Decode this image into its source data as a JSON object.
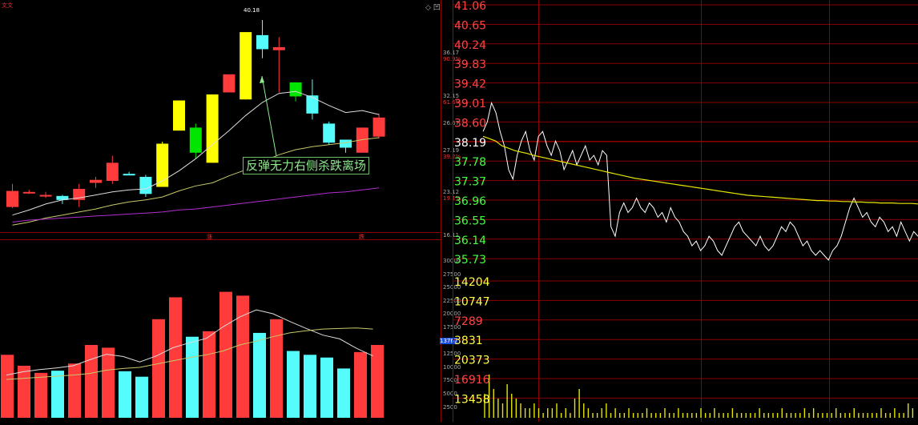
{
  "header": {
    "left_tag": "文文",
    "right_tag": "◇ 凹"
  },
  "annotation": {
    "text": "反弹无力右侧杀跌离场"
  },
  "kline_labels": {
    "high_marker": "40.18",
    "scale_top": "36.17",
    "scale_top_pct": "90.9%",
    "scale_mid": "32.15",
    "scale_mid_pct": "61.6%",
    "scale_low": "26.67",
    "scale_low2": "27.19",
    "scale_low2_pct": "39.2%",
    "scale_bottom": "23.12",
    "scale_bottom_pct": "19.1%",
    "scale_base": "16.11",
    "marker_a": "涨",
    "marker_b": "跌"
  },
  "volume_axis": {
    "ticks": [
      "30000",
      "27500",
      "25000",
      "22500",
      "20000",
      "17500",
      "13767",
      "12500",
      "10000",
      "7500",
      "5000",
      "2500"
    ],
    "highlight": "13767"
  },
  "chart_data": [
    {
      "type": "candlestick",
      "title": "",
      "candles": [
        {
          "o": 23.2,
          "h": 23.9,
          "l": 21.5,
          "c": 21.6,
          "color": "red"
        },
        {
          "o": 23.1,
          "h": 23.3,
          "l": 22.9,
          "c": 23.0,
          "color": "red"
        },
        {
          "o": 22.8,
          "h": 23.1,
          "l": 22.5,
          "c": 22.8,
          "color": "red"
        },
        {
          "o": 22.3,
          "h": 22.8,
          "l": 21.9,
          "c": 22.7,
          "color": "cyan"
        },
        {
          "o": 23.4,
          "h": 23.9,
          "l": 21.6,
          "c": 22.3,
          "color": "red"
        },
        {
          "o": 24.0,
          "h": 24.6,
          "l": 23.5,
          "c": 24.3,
          "color": "red"
        },
        {
          "o": 26.0,
          "h": 26.7,
          "l": 23.9,
          "c": 24.2,
          "color": "red"
        },
        {
          "o": 24.9,
          "h": 25.1,
          "l": 24.8,
          "c": 24.9,
          "color": "cyan"
        },
        {
          "o": 24.6,
          "h": 24.8,
          "l": 22.6,
          "c": 22.9,
          "color": "cyan"
        },
        {
          "o": 23.6,
          "h": 28.1,
          "l": 23.6,
          "c": 27.9,
          "color": "yellow"
        },
        {
          "o": 29.2,
          "h": 31.9,
          "l": 29.2,
          "c": 32.2,
          "color": "yellow"
        },
        {
          "o": 29.5,
          "h": 29.9,
          "l": 26.4,
          "c": 27.0,
          "color": "green"
        },
        {
          "o": 26.0,
          "h": 32.8,
          "l": 26.0,
          "c": 32.8,
          "color": "yellow"
        },
        {
          "o": 33.0,
          "h": 34.8,
          "l": 33.0,
          "c": 34.8,
          "color": "red"
        },
        {
          "o": 32.3,
          "h": 39.0,
          "l": 32.3,
          "c": 39.0,
          "color": "yellow"
        },
        {
          "o": 38.7,
          "h": 40.2,
          "l": 36.4,
          "c": 37.3,
          "color": "cyan"
        },
        {
          "o": 37.5,
          "h": 38.5,
          "l": 33.0,
          "c": 37.2,
          "color": "red"
        },
        {
          "o": 34.0,
          "h": 34.0,
          "l": 32.1,
          "c": 32.6,
          "color": "green"
        },
        {
          "o": 32.7,
          "h": 34.3,
          "l": 30.3,
          "c": 30.9,
          "color": "cyan"
        },
        {
          "o": 29.9,
          "h": 30.1,
          "l": 27.8,
          "c": 28.0,
          "color": "cyan"
        },
        {
          "o": 28.3,
          "h": 28.3,
          "l": 27.0,
          "c": 27.5,
          "color": "cyan"
        },
        {
          "o": 29.5,
          "h": 29.5,
          "l": 27.0,
          "c": 27.0,
          "color": "red"
        },
        {
          "o": 30.5,
          "h": 30.9,
          "l": 28.4,
          "c": 28.6,
          "color": "red"
        }
      ],
      "ma_white": [
        20.8,
        21.3,
        21.9,
        22.3,
        22.5,
        22.8,
        23.1,
        23.3,
        23.4,
        24.2,
        25.2,
        26.4,
        27.8,
        29.2,
        30.7,
        32.0,
        32.9,
        33.1,
        32.5,
        31.7,
        31.0,
        31.2,
        30.8
      ],
      "ma_yellow": [
        19.8,
        20.1,
        20.5,
        20.8,
        21.1,
        21.4,
        21.8,
        22.1,
        22.3,
        22.6,
        23.2,
        23.7,
        24.0,
        24.7,
        25.3,
        26.1,
        26.8,
        27.3,
        27.6,
        27.8,
        28.0,
        28.3,
        28.5
      ],
      "ma_purple": [
        20.1,
        20.3,
        20.4,
        20.5,
        20.6,
        20.7,
        20.8,
        20.9,
        21.0,
        21.1,
        21.3,
        21.4,
        21.6,
        21.8,
        22.0,
        22.2,
        22.4,
        22.6,
        22.8,
        23.0,
        23.1,
        23.3,
        23.5
      ]
    },
    {
      "type": "bar",
      "title": "",
      "ylim": [
        0,
        32000
      ],
      "values": [
        11500,
        9500,
        8200,
        8600,
        9900,
        13300,
        12800,
        8500,
        7500,
        18000,
        22000,
        14800,
        15800,
        23000,
        22300,
        15500,
        18000,
        12200,
        11500,
        11000,
        9000,
        12000,
        13300
      ],
      "colors": [
        "red",
        "red",
        "red",
        "cyan",
        "red",
        "red",
        "red",
        "cyan",
        "cyan",
        "red",
        "red",
        "cyan",
        "red",
        "red",
        "red",
        "cyan",
        "red",
        "cyan",
        "cyan",
        "cyan",
        "cyan",
        "red",
        "red"
      ],
      "ma_white": [
        7800,
        8400,
        8800,
        9100,
        9500,
        10600,
        11600,
        11200,
        10200,
        11300,
        12800,
        13700,
        14500,
        16600,
        18400,
        19700,
        19000,
        17600,
        16300,
        15100,
        14400,
        12700,
        11300
      ],
      "ma_yellow": [
        7000,
        7200,
        7400,
        7600,
        7800,
        8100,
        8700,
        9000,
        9200,
        9800,
        10400,
        11000,
        11500,
        12200,
        13300,
        14000,
        14800,
        15500,
        15900,
        16200,
        16300,
        16400,
        16200
      ]
    },
    {
      "type": "line",
      "title": "",
      "y_ticks": [
        "41.06",
        "40.65",
        "40.24",
        "39.83",
        "39.42",
        "39.01",
        "38.60",
        "38.19",
        "37.78",
        "37.37",
        "36.96",
        "36.55",
        "36.14",
        "35.73"
      ],
      "y_tick_colors": [
        "#ff4444",
        "#ff4444",
        "#ff4444",
        "#ff4444",
        "#ff4444",
        "#ff4444",
        "#ff4444",
        "#ffffff",
        "#44ff44",
        "#44ff44",
        "#44ff44",
        "#44ff44",
        "#44ff44",
        "#44ff44"
      ],
      "ylim": [
        35.73,
        41.06
      ],
      "price": [
        38.4,
        38.6,
        39.0,
        38.8,
        38.4,
        38.1,
        37.6,
        37.4,
        37.9,
        38.2,
        38.4,
        38.0,
        37.8,
        38.3,
        38.4,
        38.1,
        37.9,
        38.2,
        38.0,
        37.6,
        37.8,
        38.0,
        37.7,
        37.9,
        38.1,
        37.8,
        37.9,
        37.7,
        38.0,
        37.9,
        36.4,
        36.2,
        36.7,
        36.9,
        36.7,
        36.8,
        37.0,
        36.8,
        36.7,
        36.9,
        36.8,
        36.6,
        36.7,
        36.5,
        36.8,
        36.6,
        36.5,
        36.3,
        36.2,
        36.0,
        36.1,
        35.9,
        36.0,
        36.2,
        36.1,
        35.9,
        35.8,
        36.0,
        36.2,
        36.4,
        36.5,
        36.3,
        36.2,
        36.1,
        36.0,
        36.2,
        36.0,
        35.9,
        36.0,
        36.2,
        36.4,
        36.3,
        36.5,
        36.4,
        36.2,
        36.0,
        36.1,
        35.9,
        35.8,
        35.9,
        35.8,
        35.7,
        35.9,
        36.0,
        36.2,
        36.5,
        36.8,
        37.0,
        36.8,
        36.6,
        36.7,
        36.5,
        36.4,
        36.6,
        36.5,
        36.3,
        36.4,
        36.2,
        36.5,
        36.3,
        36.1,
        36.3,
        36.2
      ],
      "avg": [
        38.3,
        38.25,
        38.2,
        38.1,
        38.05,
        38.0,
        37.97,
        37.94,
        37.9,
        37.87,
        37.84,
        37.81,
        37.78,
        37.75,
        37.72,
        37.69,
        37.66,
        37.63,
        37.6,
        37.57,
        37.54,
        37.51,
        37.48,
        37.45,
        37.42,
        37.4,
        37.38,
        37.36,
        37.34,
        37.32,
        37.3,
        37.28,
        37.26,
        37.24,
        37.22,
        37.2,
        37.18,
        37.16,
        37.14,
        37.12,
        37.1,
        37.08,
        37.06,
        37.05,
        37.04,
        37.03,
        37.02,
        37.01,
        37.0,
        36.99,
        36.98,
        36.97,
        36.96,
        36.95,
        36.95,
        36.94,
        36.94,
        36.93,
        36.93,
        36.92,
        36.92,
        36.91,
        36.91,
        36.9,
        36.9,
        36.9,
        36.89,
        36.89,
        36.89,
        36.88
      ]
    },
    {
      "type": "bar",
      "title": "",
      "y_ticks": [
        "14204",
        "10747",
        "7289",
        "3831",
        "20373",
        "16916",
        "13458"
      ],
      "y_tick_colors": [
        "#ffff44",
        "#ffff44",
        "#ff4444",
        "#ffff44",
        "#ffff44",
        "#ff4444",
        "#ffff44"
      ],
      "values": [
        5,
        9,
        6,
        4,
        3,
        7,
        5,
        4,
        3,
        2,
        2,
        3,
        2,
        1,
        2,
        2,
        3,
        1,
        2,
        1,
        4,
        6,
        3,
        2,
        1,
        1,
        2,
        3,
        1,
        2,
        1,
        1,
        2,
        1,
        1,
        1,
        2,
        1,
        1,
        1,
        2,
        1,
        1,
        2,
        1,
        1,
        1,
        1,
        2,
        1,
        1,
        2,
        1,
        1,
        1,
        2,
        1,
        1,
        1,
        1,
        1,
        2,
        1,
        1,
        1,
        1,
        2,
        1,
        1,
        1,
        1,
        2,
        1,
        2,
        1,
        1,
        1,
        1,
        2,
        1,
        1,
        1,
        2,
        1,
        1,
        1,
        1,
        1,
        2,
        1,
        1,
        2,
        1,
        1,
        3,
        2
      ]
    }
  ]
}
